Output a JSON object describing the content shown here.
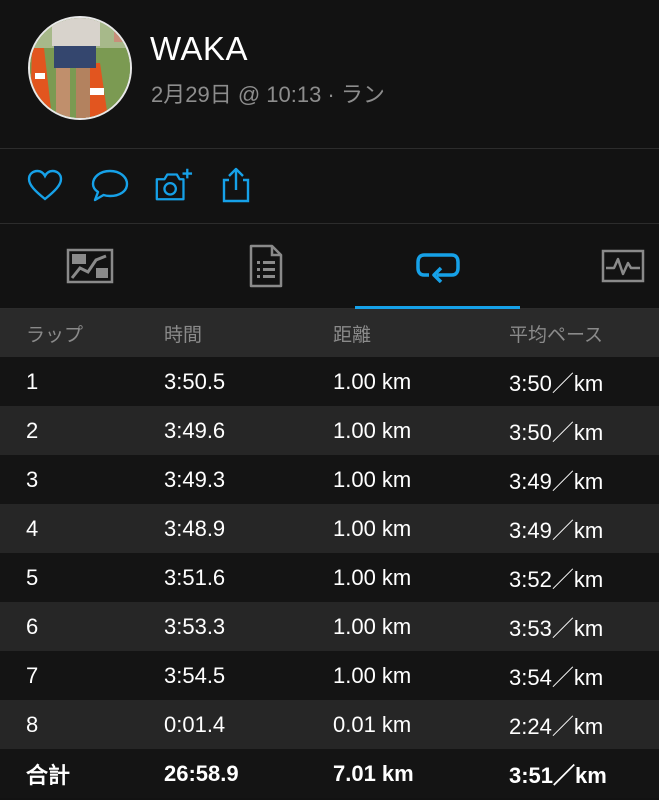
{
  "header": {
    "name": "WAKA",
    "subtitle": "2月29日 @ 10:13 · ラン"
  },
  "actions": {
    "icons": [
      "heart-icon",
      "comment-icon",
      "camera-plus-icon",
      "share-icon"
    ]
  },
  "tabs": [
    {
      "icon": "map-icon",
      "active": false
    },
    {
      "icon": "details-document-icon",
      "active": false
    },
    {
      "icon": "laps-loop-icon",
      "active": true
    },
    {
      "icon": "chart-monitor-icon",
      "active": false
    }
  ],
  "laps": {
    "columns": [
      "ラップ",
      "時間",
      "距離",
      "平均ペース"
    ],
    "rows": [
      [
        "1",
        "3:50.5",
        "1.00 km",
        "3:50／km"
      ],
      [
        "2",
        "3:49.6",
        "1.00 km",
        "3:50／km"
      ],
      [
        "3",
        "3:49.3",
        "1.00 km",
        "3:49／km"
      ],
      [
        "4",
        "3:48.9",
        "1.00 km",
        "3:49／km"
      ],
      [
        "5",
        "3:51.6",
        "1.00 km",
        "3:52／km"
      ],
      [
        "6",
        "3:53.3",
        "1.00 km",
        "3:53／km"
      ],
      [
        "7",
        "3:54.5",
        "1.00 km",
        "3:54／km"
      ],
      [
        "8",
        "0:01.4",
        "0.01 km",
        "2:24／km"
      ]
    ],
    "total": [
      "合計",
      "26:58.9",
      "7.01 km",
      "3:51／km"
    ]
  },
  "colors": {
    "accent": "#16a1e8",
    "background": "#121212",
    "row_alt": "#262626",
    "header_row": "#2a2a2a",
    "muted_text": "#8d8d8d"
  }
}
